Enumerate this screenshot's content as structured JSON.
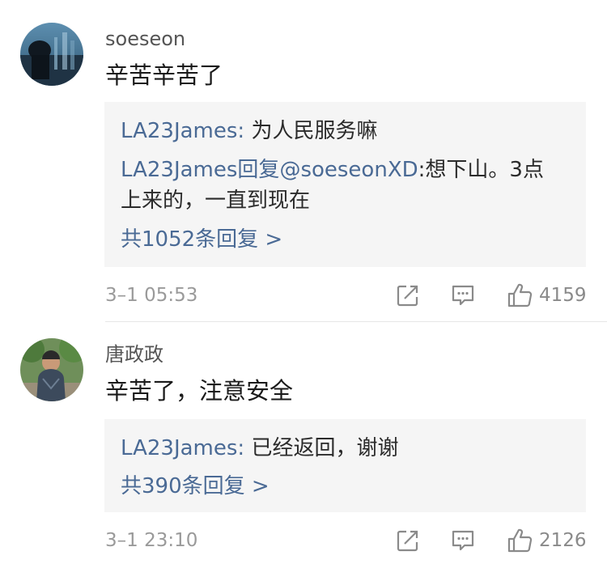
{
  "comments": [
    {
      "username": "soeseon",
      "text": "辛苦辛苦了",
      "replies": [
        {
          "author": "LA23James",
          "sep": ": ",
          "text": "为人民服务嘛"
        },
        {
          "author": "LA23James",
          "mid": "回复",
          "mention": "@soeseonXD",
          "sep": ":",
          "text_line1": "想下山。3点",
          "text_line2": "上来的，一直到现在"
        }
      ],
      "more_replies": "共1052条回复 >",
      "time": "3–1 05:53",
      "likes": "4159"
    },
    {
      "username": "唐政政",
      "text": "辛苦了，注意安全",
      "replies": [
        {
          "author": "LA23James",
          "sep": ": ",
          "text": "已经返回，谢谢"
        }
      ],
      "more_replies": "共390条回复 >",
      "time": "3–1 23:10",
      "likes": "2126"
    }
  ],
  "icons": {
    "share": "share-icon",
    "comment": "comment-icon",
    "like": "thumbs-up-icon"
  },
  "colors": {
    "link": "#4a6a95",
    "reply_bg": "#f5f5f5",
    "meta": "#9a9a9a"
  }
}
